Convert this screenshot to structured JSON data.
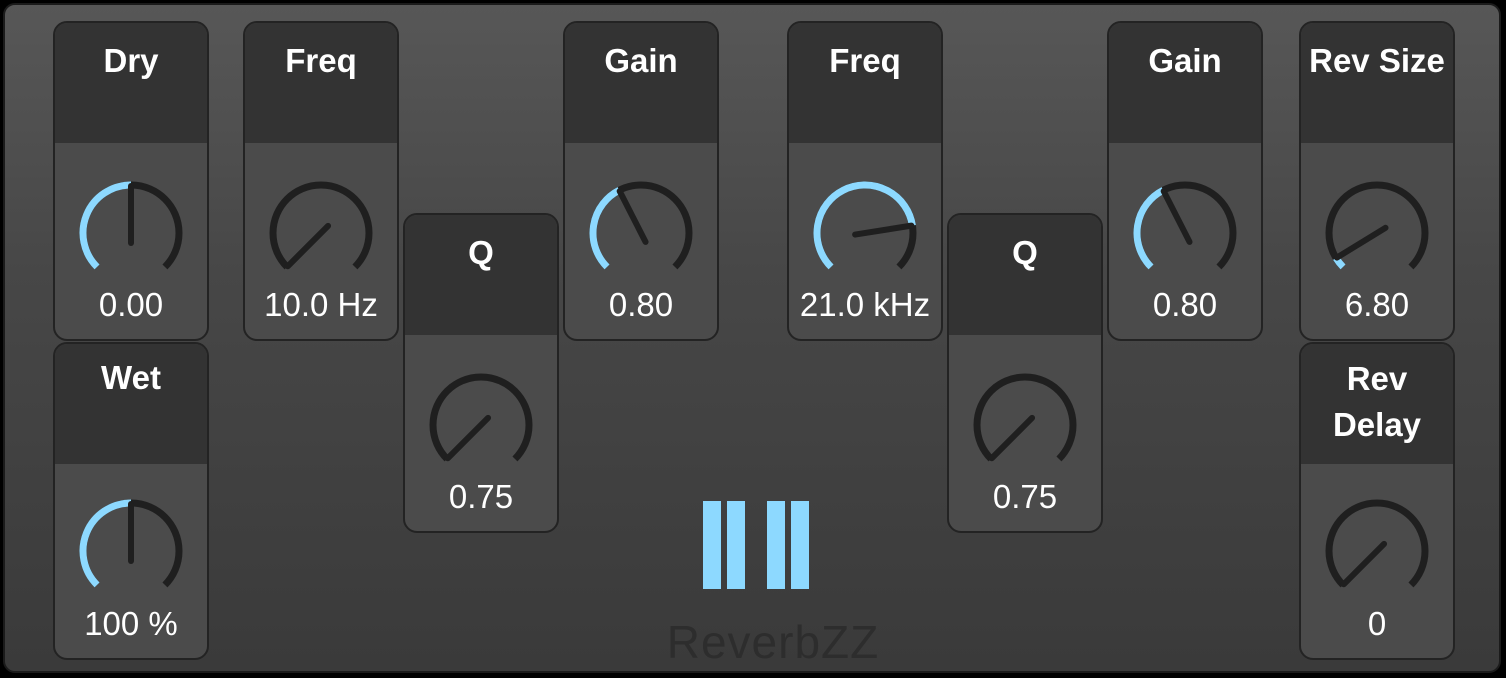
{
  "colors": {
    "accent": "#8dd9ff",
    "track": "#1f1f1f",
    "panel": "#4b4b4b",
    "header": "#333333"
  },
  "modules": {
    "dry": {
      "label": "Dry",
      "value": "0.00",
      "level": 0.5
    },
    "wet": {
      "label": "Wet",
      "value": "100 %",
      "level": 0.5
    },
    "freq1": {
      "label": "Freq",
      "value": "10.0 Hz",
      "level": 0.0
    },
    "q1": {
      "label": "Q",
      "value": "0.75",
      "level": 0.0
    },
    "gain1": {
      "label": "Gain",
      "value": "0.80",
      "level": 0.4
    },
    "freq2": {
      "label": "Freq",
      "value": "21.0 kHz",
      "level": 0.8
    },
    "q2": {
      "label": "Q",
      "value": "0.75",
      "level": 0.0
    },
    "gain2": {
      "label": "Gain",
      "value": "0.80",
      "level": 0.4
    },
    "rev_size": {
      "label": "Rev Size",
      "value": "6.80",
      "level": 0.05
    },
    "rev_delay": {
      "label": "Rev\nDelay",
      "value": "0",
      "level": 0.0
    }
  },
  "brand": {
    "name": "ReverbZZ",
    "logo_icon": "bars-logo-icon"
  }
}
